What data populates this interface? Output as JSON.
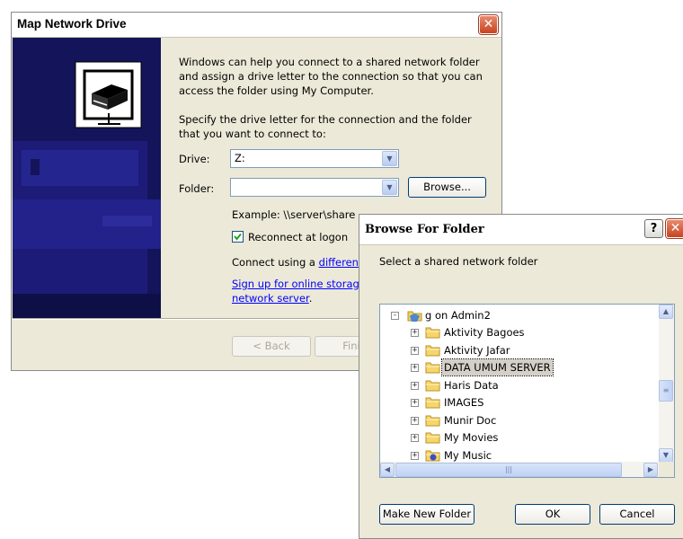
{
  "map_dialog": {
    "title": "Map Network Drive",
    "intro": [
      "Windows can help you connect to a shared network folder",
      "and assign a drive letter to the connection so that you can",
      "access the folder using My Computer."
    ],
    "specify": [
      "Specify the drive letter for the connection and the folder",
      "that you want to connect to:"
    ],
    "drive_label": "Drive:",
    "drive_value": "Z:",
    "folder_label": "Folder:",
    "folder_value": "",
    "browse_label": "Browse...",
    "example": "Example: \\\\server\\share",
    "reconnect_label": "Reconnect at logon",
    "reconnect_checked": true,
    "connect_prefix": "Connect using a ",
    "connect_link": "differen",
    "signup_link_1": "Sign up for online storag",
    "signup_link_2": "network server",
    "signup_suffix": ".",
    "back_label": "< Back",
    "finish_label": "Finis"
  },
  "browse_dialog": {
    "title": "Browse For Folder",
    "help_icon": "?",
    "close_icon": "X",
    "prompt": "Select a shared network folder",
    "root": "g on Admin2",
    "items": [
      {
        "label": "Aktivity Bagoes"
      },
      {
        "label": "Aktivity Jafar"
      },
      {
        "label": "DATA UMUM SERVER",
        "selected": true
      },
      {
        "label": "Haris Data"
      },
      {
        "label": "IMAGES"
      },
      {
        "label": "Munir Doc"
      },
      {
        "label": "My Movies"
      },
      {
        "label": "My Music",
        "special": true
      }
    ],
    "make_new_folder": "Make New Folder",
    "ok": "OK",
    "cancel": "Cancel"
  },
  "colors": {
    "wizard_banner": "#14145a",
    "dialog_face": "#ece9d8",
    "selection": "#d4d0c8",
    "close_button": "#c8431f"
  }
}
